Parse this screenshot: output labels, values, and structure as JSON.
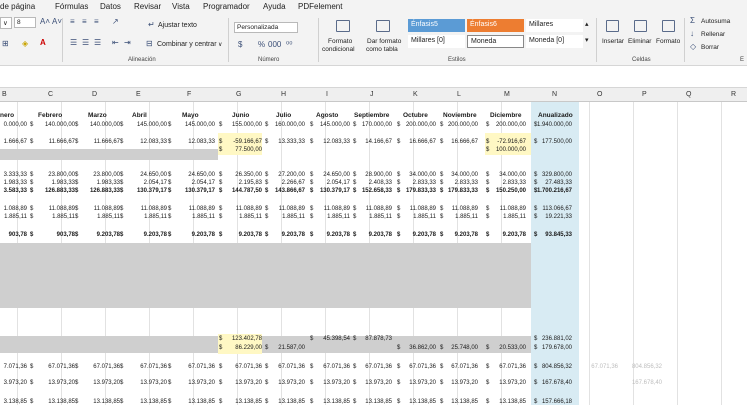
{
  "menu": [
    "de página",
    "Fórmulas",
    "Datos",
    "Revisar",
    "Vista",
    "Programador",
    "Ayuda",
    "PDFelement"
  ],
  "ribbon": {
    "font_size": "8",
    "wrap_text": "Ajustar texto",
    "merge_center": "Combinar y centrar",
    "number_format": "Personalizada",
    "currency_sym": "$",
    "percent_sym": "%",
    "comma_sym": "000",
    "cond_format_1": "Formato",
    "cond_format_2": "condicional",
    "table_format_1": "Dar formato",
    "table_format_2": "como tabla",
    "styles": {
      "enfasis5": "Énfasis5",
      "enfasis6": "Énfasis6",
      "millares": "Millares",
      "millares0": "Millares [0]",
      "moneda": "Moneda",
      "moneda0": "Moneda [0]"
    },
    "insert": "Insertar",
    "delete": "Eliminar",
    "format": "Formato",
    "autosum": "Autosuma",
    "fill": "Rellenar",
    "clear": "Borrar",
    "groups": {
      "alineacion": "Alineación",
      "numero": "Número",
      "estilos": "Estilos",
      "celdas": "Celdas",
      "edicion": "E"
    }
  },
  "columns": [
    "B",
    "C",
    "D",
    "E",
    "F",
    "G",
    "H",
    "I",
    "J",
    "K",
    "L",
    "M",
    "N",
    "O",
    "P",
    "Q",
    "R"
  ],
  "months": [
    "nero",
    "Febrero",
    "Marzo",
    "Abril",
    "Mayo",
    "Junio",
    "Julio",
    "Agosto",
    "Septiembre",
    "Octubre",
    "Noviembre",
    "Diciembre",
    "Anualizado"
  ],
  "rows": {
    "r1": [
      "0.000,00",
      "140.000,00",
      "140.000,00",
      "145.000,00",
      "145.000,00",
      "155.000,00",
      "160.000,00",
      "145.000,00",
      "170.000,00",
      "200.000,00",
      "200.000,00",
      "200.000,00",
      "1.940.000,00"
    ],
    "r2": [
      "1.666,67",
      "11.666,67",
      "11.666,67",
      "12.083,33",
      "12.083,33",
      "-59.166,67",
      "13.333,33",
      "12.083,33",
      "14.166,67",
      "16.666,67",
      "16.666,67",
      "-72.916,67",
      "177.500,00"
    ],
    "r2b": [
      "77.500,00",
      "100.000,00"
    ],
    "r3": [
      "3.333,33",
      "23.800,00",
      "23.800,00",
      "24.650,00",
      "24.650,00",
      "26.350,00",
      "27.200,00",
      "24.650,00",
      "28.900,00",
      "34.000,00",
      "34.000,00",
      "34.000,00",
      "329.800,00"
    ],
    "r4": [
      "1.983,33",
      "1.983,33",
      "1.983,33",
      "2.054,17",
      "2.054,17",
      "2.195,83",
      "2.266,67",
      "2.054,17",
      "2.408,33",
      "2.833,33",
      "2.833,33",
      "2.833,33",
      "27.483,33"
    ],
    "r5": [
      "3.583,33",
      "126.883,33",
      "126.883,33",
      "130.379,17",
      "130.379,17",
      "144.787,50",
      "143.866,67",
      "130.379,17",
      "152.658,33",
      "179.833,33",
      "179.833,33",
      "150.250,00",
      "1.700.216,67"
    ],
    "r6": [
      "1.088,89",
      "11.088,89",
      "11.088,89",
      "11.088,89",
      "11.088,89",
      "11.088,89",
      "11.088,89",
      "11.088,89",
      "11.088,89",
      "11.088,89",
      "11.088,89",
      "11.088,89",
      "113.066,67"
    ],
    "r7": [
      "1.885,11",
      "1.885,11",
      "1.885,11",
      "1.885,11",
      "1.885,11",
      "1.885,11",
      "1.885,11",
      "1.885,11",
      "1.885,11",
      "1.885,11",
      "1.885,11",
      "1.885,11",
      "19.221,33"
    ],
    "r8": [
      "903,78",
      "903,78",
      "9.203,78",
      "9.203,78",
      "9.203,78",
      "9.203,78",
      "9.203,78",
      "9.203,78",
      "9.203,78",
      "9.203,78",
      "9.203,78",
      "9.203,78",
      "93.845,33"
    ],
    "r9": [
      "123.402,78",
      "45.398,54",
      "87.878,73",
      "236.881,02"
    ],
    "r10": [
      "86.229,00",
      "21.587,00",
      "36.862,00",
      "25.748,00",
      "20.533,00",
      "179.678,00"
    ],
    "r11": [
      "7.071,36",
      "67.071,36",
      "67.071,36",
      "67.071,36",
      "67.071,36",
      "67.071,36",
      "67.071,36",
      "67.071,36",
      "67.071,36",
      "67.071,36",
      "67.071,36",
      "67.071,36",
      "804.856,32"
    ],
    "r12": [
      "3.973,20",
      "13.973,20",
      "13.973,20",
      "13.973,20",
      "13.973,20",
      "13.973,20",
      "13.973,20",
      "13.973,20",
      "13.973,20",
      "13.973,20",
      "13.973,20",
      "13.973,20",
      "167.678,40"
    ],
    "r13": [
      "3.138,85",
      "13.138,85",
      "13.138,85",
      "13.138,85",
      "13.138,85",
      "13.138,85",
      "13.138,85",
      "13.138,85",
      "13.138,85",
      "13.138,85",
      "13.138,85",
      "13.138,85",
      "157.666,18"
    ],
    "faint": [
      "67.071,36",
      "804.856,32",
      "167.678,40"
    ]
  },
  "currency_col": "$",
  "dash": "-"
}
